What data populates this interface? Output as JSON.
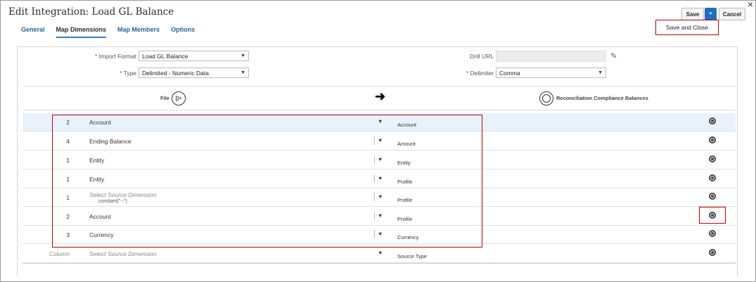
{
  "window": {
    "title": "Edit Integration: Load GL Balance",
    "close_glyph": "×"
  },
  "tabs": [
    {
      "label": "General",
      "active": false
    },
    {
      "label": "Map Dimensions",
      "active": true
    },
    {
      "label": "Map Members",
      "active": false
    },
    {
      "label": "Options",
      "active": false
    }
  ],
  "toolbar": {
    "save_label": "Save",
    "cancel_label": "Cancel",
    "save_and_close_label": "Save and Close"
  },
  "form": {
    "import_format": {
      "label": "Import Format",
      "value": "Load GL Balance"
    },
    "type": {
      "label": "Type",
      "value": "Delimited - Numeric Data"
    },
    "drill_url": {
      "label": "Drill URL",
      "value": ""
    },
    "delimiter": {
      "label": "Delimiter",
      "value": "Comma"
    },
    "required_marker": "*"
  },
  "mapping_header": {
    "source_label": "File",
    "target_label": "Reconciliation Compliance Balances",
    "arrow_glyph": "➜"
  },
  "rows": [
    {
      "num": "2",
      "source": "Account",
      "sub": "",
      "target": "Account",
      "selected": true
    },
    {
      "num": "4",
      "source": "Ending Balance",
      "sub": "",
      "target": "Amount",
      "selected": false
    },
    {
      "num": "1",
      "source": "Entity",
      "sub": "",
      "target": "Entity",
      "selected": false
    },
    {
      "num": "1",
      "source": "Entity",
      "sub": "",
      "target": "Profile",
      "selected": false
    },
    {
      "num": "1",
      "source": "Select Source Dimension",
      "sub": "constant(\"--\")",
      "target": "Profile",
      "selected": false,
      "placeholder": true
    },
    {
      "num": "2",
      "source": "Account",
      "sub": "",
      "target": "Profile",
      "selected": false
    },
    {
      "num": "3",
      "source": "Currency",
      "sub": "",
      "target": "Currency",
      "selected": false
    },
    {
      "num": "Column",
      "source": "Select Source Dimension",
      "sub": "",
      "target": "Source Type",
      "selected": false,
      "placeholder": true,
      "num_placeholder": true
    }
  ],
  "icons": {
    "caret": "▼",
    "pencil": "✎",
    "file_icon": "[|>"
  },
  "colors": {
    "accent": "#1f6fbf",
    "highlight": "#c00000",
    "selected_row": "#e8f2fb"
  }
}
